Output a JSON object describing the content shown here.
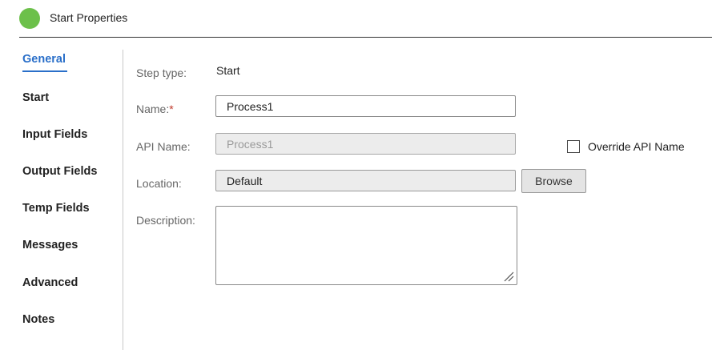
{
  "header": {
    "title": "Start Properties",
    "status_color": "#6cc04a"
  },
  "sidebar": {
    "active_index": 0,
    "accent_color": "#2a6fc9",
    "items": [
      {
        "label": "General"
      },
      {
        "label": "Start"
      },
      {
        "label": "Input Fields"
      },
      {
        "label": "Output Fields"
      },
      {
        "label": "Temp Fields"
      },
      {
        "label": "Messages"
      },
      {
        "label": "Advanced"
      },
      {
        "label": "Notes"
      }
    ]
  },
  "form": {
    "step_type": {
      "label": "Step type:",
      "value": "Start"
    },
    "name": {
      "label": "Name:",
      "required_marker": "*",
      "value": "Process1"
    },
    "api_name": {
      "label": "API Name:",
      "value": "Process1",
      "disabled": true
    },
    "override_api_name": {
      "label": "Override API Name",
      "checked": false
    },
    "location": {
      "label": "Location:",
      "value": "Default",
      "browse_label": "Browse"
    },
    "description": {
      "label": "Description:",
      "value": ""
    }
  }
}
